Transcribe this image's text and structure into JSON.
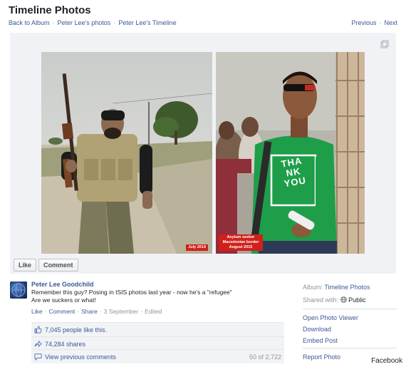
{
  "header": {
    "title": "Timeline Photos",
    "breadcrumbs": [
      "Back to Album",
      "Peter Lee's photos",
      "Peter Lee's Timeline"
    ],
    "previous": "Previous",
    "next": "Next"
  },
  "photos": {
    "left_tag": "July 2014",
    "right_tag_lines": [
      "Asylum seeker",
      "Macedonian border",
      "August 2015"
    ],
    "shirt_text": [
      "THA",
      "NK",
      "YOU"
    ]
  },
  "buttons": {
    "like": "Like",
    "comment": "Comment"
  },
  "post": {
    "author": "Peter Lee Goodchild",
    "line1": "Remember this guy? Posing in ISIS photos last year - now he's a \"refugee\"",
    "line2": "Are we suckers or what!",
    "like": "Like",
    "comment": "Comment",
    "share": "Share",
    "date": "3 September",
    "edited": "Edited"
  },
  "ufi": {
    "likes": "7,045 people like this.",
    "shares": "74,284 shares",
    "view_comments": "View previous comments",
    "comment_count": "50 of 2,722"
  },
  "sidebar": {
    "album_label": "Album:",
    "album_value": "Timeline Photos",
    "shared_label": "Shared with:",
    "shared_value": "Public",
    "links": [
      "Open Photo Viewer",
      "Download",
      "Embed Post"
    ],
    "report": "Report Photo"
  },
  "watermark": "Facebook"
}
